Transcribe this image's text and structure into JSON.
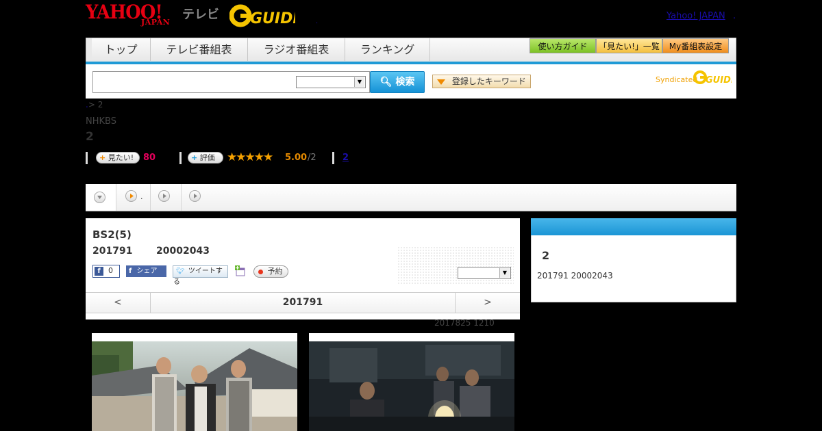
{
  "header": {
    "yahoo_logo": "YAHOO!",
    "yahoo_logo_sub": "JAPAN",
    "tv_label": "テレビ",
    "gguide_logo": "GUIDE",
    "dot": ".",
    "yahoo_japan_link": "Yahoo! JAPAN",
    "trailing_dot": "."
  },
  "nav": {
    "items": [
      {
        "label": "トップ"
      },
      {
        "label": "テレビ番組表"
      },
      {
        "label": "ラジオ番組表"
      },
      {
        "label": "ランキング"
      }
    ],
    "guide_buttons": [
      {
        "label": "使い方ガイド",
        "color": "#8ccf2a"
      },
      {
        "label": "「見たい!」一覧",
        "color": "#f7c94a"
      },
      {
        "label": "My番組表設定",
        "color": "#f39a2b"
      }
    ]
  },
  "search": {
    "placeholder": "",
    "select_value": "",
    "button_label": "検索",
    "keyword_button_label": "登録したキーワード",
    "syndicated_label": "Syndicated",
    "syndicated_logo": "GUIDE"
  },
  "program": {
    "breadcrumb_link": ".",
    "breadcrumb_rest": "> 2",
    "station": "NHKBS",
    "title": "2",
    "mitai_label": "見たい!",
    "mitai_count": "80",
    "rate_label": "評価",
    "stars": "★★★★★",
    "rating": "5.00",
    "rating_max": "/2",
    "link_count": "2"
  },
  "tabs": [
    {
      "label": ""
    },
    {
      "label": "."
    },
    {
      "label": ""
    },
    {
      "label": ""
    }
  ],
  "schedule": {
    "title": "BS2(5)",
    "date": "201791",
    "time": "20002043",
    "fb_like_count": "0",
    "fb_share_label": "シェア",
    "tweet_label": "ツイートする",
    "reserve_label": "予約",
    "select_value": "",
    "prev_label": "<",
    "current_date": "201791",
    "next_label": ">",
    "updated": "2017825  1210"
  },
  "side": {
    "title": "2",
    "date_time": "201791  20002043"
  },
  "photos": [
    {
      "name": "still-1"
    },
    {
      "name": "still-2"
    }
  ],
  "colors": {
    "accent_blue": "#1f9ad6",
    "mitai_pink": "#e6005c",
    "rating_orange": "#e58a00",
    "yahoo_red": "#e60012"
  }
}
